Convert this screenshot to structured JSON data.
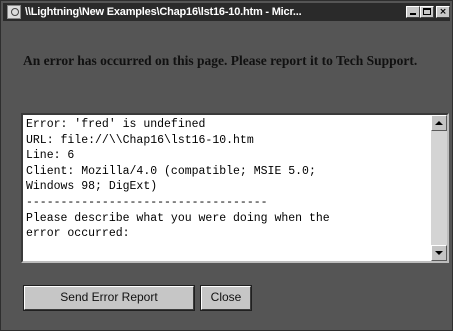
{
  "window": {
    "title": "\\\\Lightning\\New Examples\\Chap16\\lst16-10.htm - Micr..."
  },
  "dialog": {
    "message": "An error has occurred on this page. Please report it to Tech Support.",
    "details": "Error: 'fred' is undefined\nURL: file://\\\\Chap16\\lst16-10.htm\nLine: 6\nClient: Mozilla/4.0 (compatible; MSIE 5.0;\nWindows 98; DigExt)\n-----------------------------------\nPlease describe what you were doing when the\nerror occurred:"
  },
  "buttons": {
    "send_label": "Send Error Report",
    "close_label": "Close"
  },
  "title_buttons": {
    "close_glyph": "×"
  },
  "colors": {
    "dialog_background": "#555555",
    "titlebar_background": "#2a2a2a",
    "text_background": "#ffffff"
  }
}
